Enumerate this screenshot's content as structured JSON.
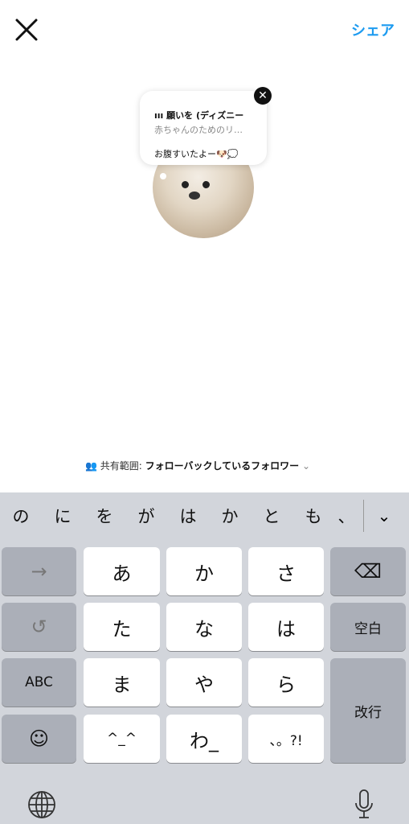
{
  "header": {
    "share_label": "シェア"
  },
  "note": {
    "music_title": "願いを (ディズニー",
    "music_artist": "赤ちゃんのためのリ…",
    "text": "お腹すいたよー🐶💭"
  },
  "audience": {
    "label": "共有範囲:",
    "value": "フォローバックしているフォロワー"
  },
  "keyboard": {
    "candidates": [
      "の",
      "に",
      "を",
      "が",
      "は",
      "か",
      "と",
      "も",
      "、"
    ],
    "keys": {
      "arrow": "→",
      "a": "あ",
      "ka": "か",
      "sa": "さ",
      "ta": "た",
      "na": "な",
      "ha": "は",
      "abc": "ABC",
      "ma": "ま",
      "ya": "や",
      "ra": "ら",
      "kaomoji": "^_^",
      "wa": "わ_",
      "punct": "、。?!",
      "space": "空白",
      "enter": "改行"
    }
  }
}
